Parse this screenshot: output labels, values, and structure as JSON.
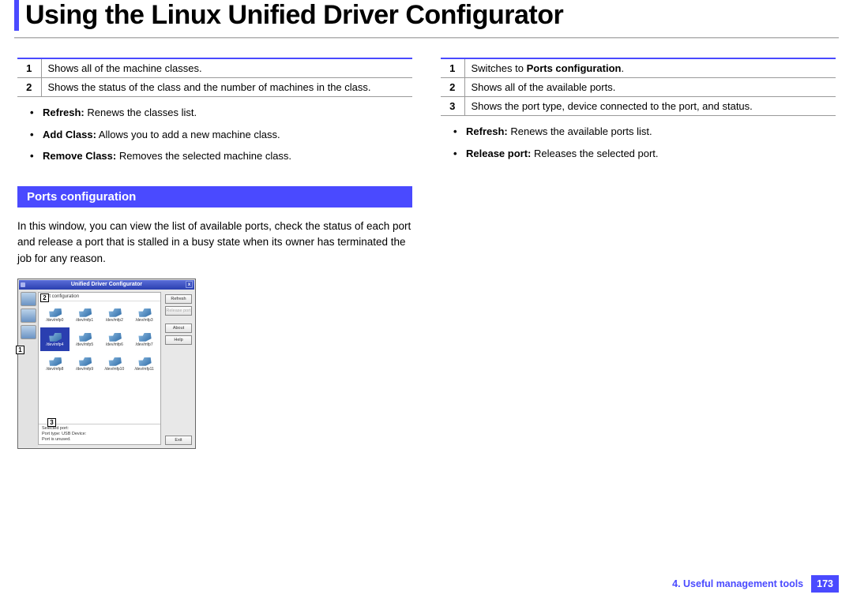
{
  "header": {
    "title": "Using the Linux Unified Driver Configurator"
  },
  "left": {
    "table": [
      {
        "n": "1",
        "t": "Shows all of the machine classes."
      },
      {
        "n": "2",
        "t": "Shows the status of the class and the number of machines in the class."
      }
    ],
    "bullets": [
      {
        "b": "Refresh:",
        "t": " Renews the classes list."
      },
      {
        "b": "Add Class:",
        "t": " Allows you to add a new machine class."
      },
      {
        "b": "Remove Class:",
        "t": " Removes the selected machine class."
      }
    ],
    "section": "Ports configuration",
    "body": "In this window, you can view the list of available ports, check the status of each port and release a port that is stalled in a busy state when its owner has terminated the job for any reason."
  },
  "shot": {
    "title": "Unified Driver Configurator",
    "header": "Port configuration",
    "ports": [
      "/dev/mfp0",
      "/dev/mfp1",
      "/dev/mfp2",
      "/dev/mfp3",
      "/dev/mfp4",
      "/dev/mfp5",
      "/dev/mfp6",
      "/dev/mfp7",
      "/dev/mfp8",
      "/dev/mfp9",
      "/dev/mfp10",
      "/dev/mfp11"
    ],
    "selected_index": 4,
    "info_label": "Selected port:",
    "info_line1": "Port type: USB   Device:",
    "info_line2": "Port is unused.",
    "buttons": {
      "refresh": "Refresh",
      "release": "Release port",
      "about": "About",
      "help": "Help",
      "exit": "Exit"
    },
    "callouts": {
      "c1": "1",
      "c2": "2",
      "c3": "3"
    }
  },
  "right": {
    "table": [
      {
        "n": "1",
        "pre": "Switches to ",
        "b": "Ports configuration",
        "post": "."
      },
      {
        "n": "2",
        "t": "Shows all of the available ports."
      },
      {
        "n": "3",
        "t": "Shows the port type, device connected to the port, and status."
      }
    ],
    "bullets": [
      {
        "b": "Refresh:",
        "t": " Renews the available ports list."
      },
      {
        "b": "Release port:",
        "t": " Releases the selected port."
      }
    ]
  },
  "footer": {
    "chapter": "4.  Useful management tools",
    "page": "173"
  }
}
